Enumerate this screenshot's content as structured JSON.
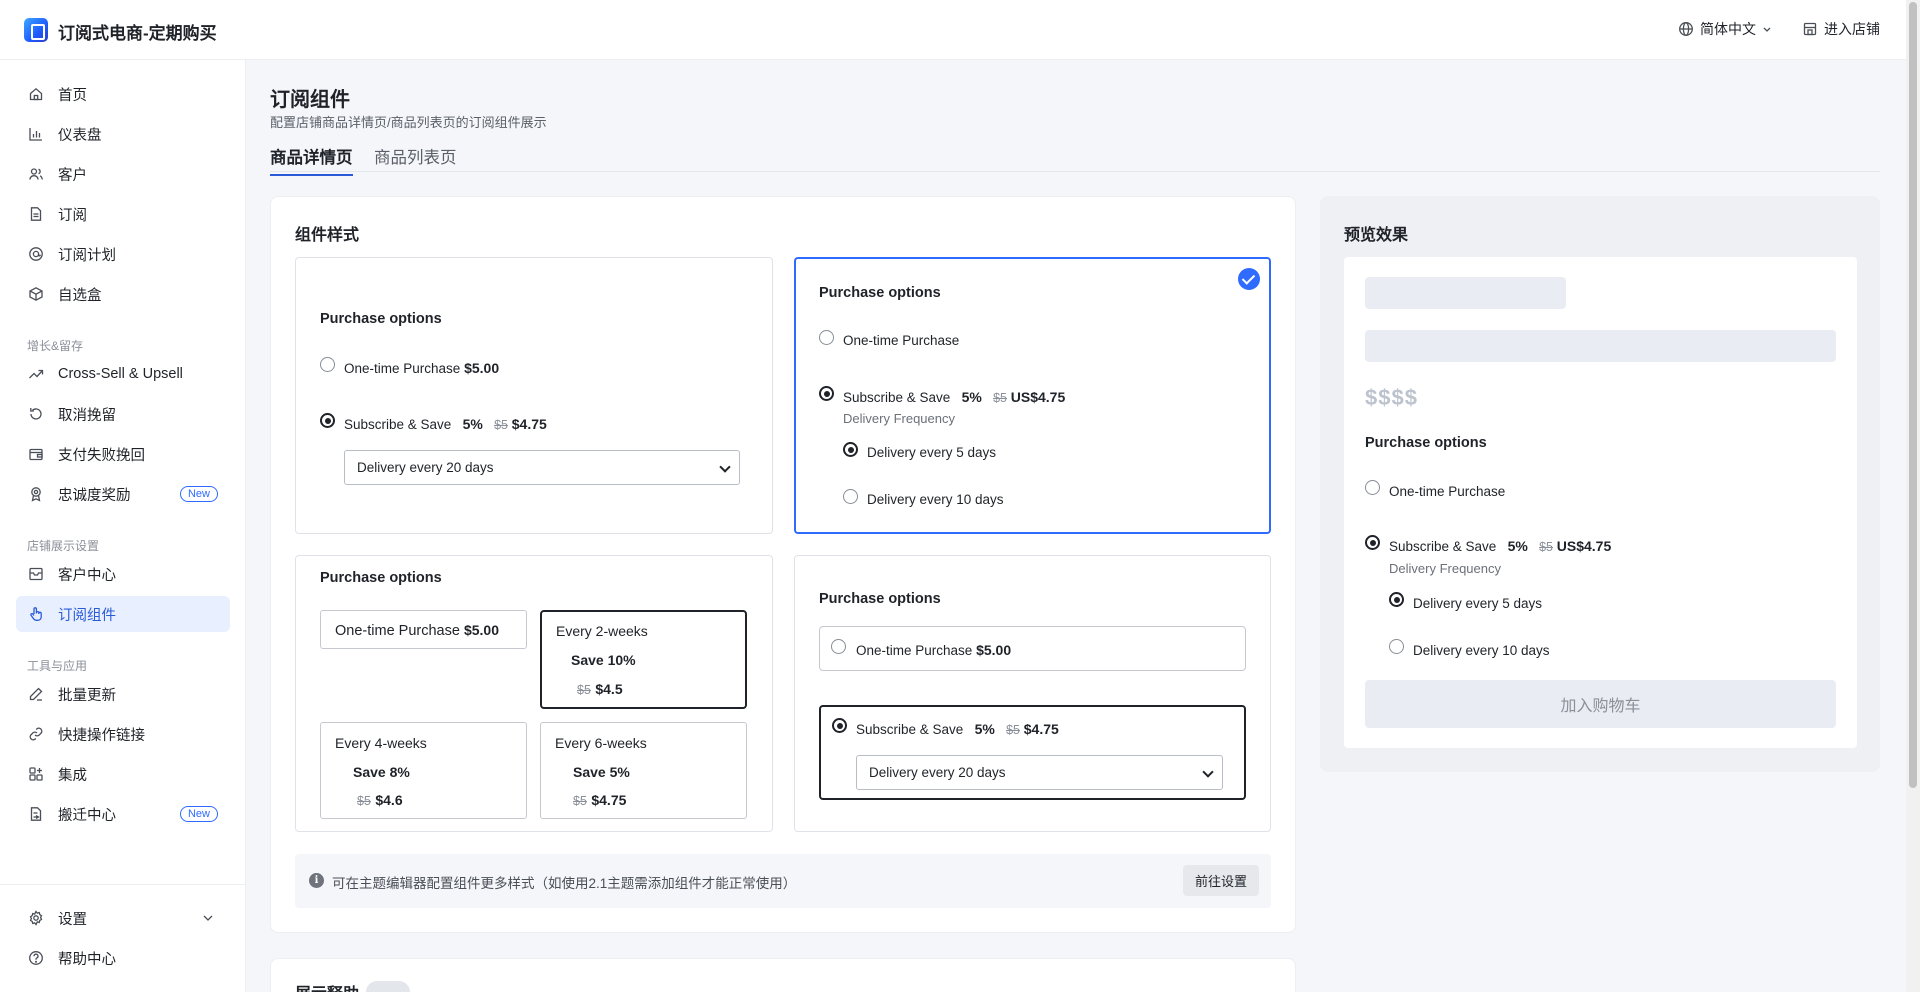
{
  "header": {
    "app_title": "订阅式电商-定期购买",
    "language": "简体中文",
    "enter_store": "进入店铺"
  },
  "sidebar": {
    "items": [
      {
        "label": "首页"
      },
      {
        "label": "仪表盘"
      },
      {
        "label": "客户"
      },
      {
        "label": "订阅"
      },
      {
        "label": "订阅计划"
      },
      {
        "label": "自选盒"
      }
    ],
    "group_growth": "增长&留存",
    "growth_items": [
      {
        "label": "Cross-Sell & Upsell"
      },
      {
        "label": "取消挽留"
      },
      {
        "label": "支付失败挽回"
      },
      {
        "label": "忠诚度奖励",
        "badge": "New"
      }
    ],
    "group_store": "店铺展示设置",
    "store_items": [
      {
        "label": "客户中心"
      },
      {
        "label": "订阅组件"
      }
    ],
    "group_tools": "工具与应用",
    "tool_items": [
      {
        "label": "批量更新"
      },
      {
        "label": "快捷操作链接"
      },
      {
        "label": "集成"
      },
      {
        "label": "搬迁中心",
        "badge": "New"
      }
    ],
    "settings": "设置",
    "help": "帮助中心"
  },
  "page": {
    "title": "订阅组件",
    "subtitle": "配置店铺商品详情页/商品列表页的订阅组件展示",
    "tabs": [
      "商品详情页",
      "商品列表页"
    ],
    "section_title": "组件样式"
  },
  "styles": {
    "po_title": "Purchase options",
    "one_time": "One-time Purchase",
    "one_time_price": "$5.00",
    "subscribe": "Subscribe & Save",
    "pct": "5%",
    "strike": "$5",
    "sub_price": "$4.75",
    "sub_price_us": "US$4.75",
    "delivery_select": "Delivery every 20 days",
    "delivery_frequency": "Delivery Frequency",
    "every5": "Delivery every 5 days",
    "every10": "Delivery every 10 days",
    "boxes": [
      {
        "title": "Every 2-weeks",
        "save": "Save 10%",
        "strike": "$5",
        "price": "$4.5"
      },
      {
        "title": "Every 4-weeks",
        "save": "Save 8%",
        "strike": "$5",
        "price": "$4.6"
      },
      {
        "title": "Every 6-weeks",
        "save": "Save 5%",
        "strike": "$5",
        "price": "$4.75"
      }
    ]
  },
  "info": {
    "text": "可在主题编辑器配置组件更多样式（如使用2.1主题需添加组件才能正常使用）",
    "button": "前往设置"
  },
  "show_label": "展示释助",
  "preview": {
    "title": "预览效果",
    "price_placeholder": "$$$$",
    "add_to_cart": "加入购物车"
  },
  "colors": {
    "accent": "#2f6bff",
    "active_bg": "#e8efff"
  }
}
